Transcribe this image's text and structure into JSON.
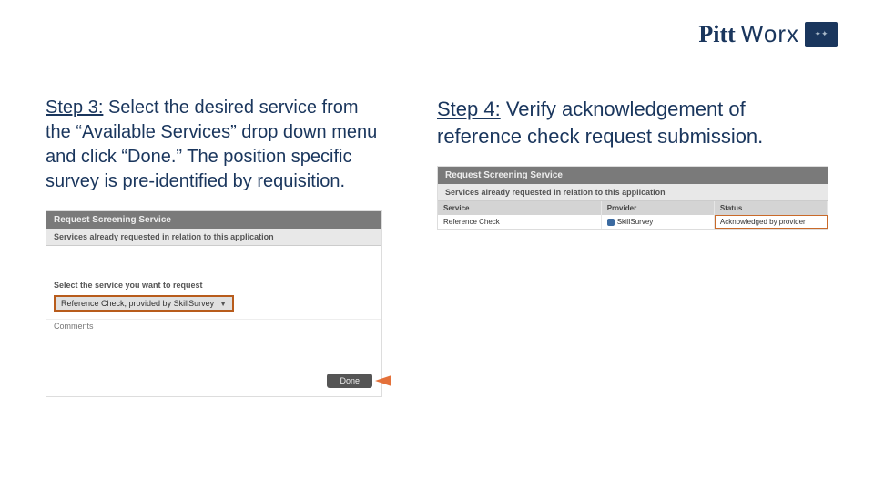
{
  "logo": {
    "brand1": "Pitt",
    "brand2": "Worx"
  },
  "step3": {
    "label": "Step 3:",
    "text": " Select the desired service from the “Available Services” drop down menu and click “Done.” The position specific survey is pre-identified by requisition."
  },
  "step4": {
    "label": "Step 4:",
    "text": " Verify acknowledgement of reference check request submission."
  },
  "left_panel": {
    "title": "Request Screening Service",
    "subtitle": "Services already requested in relation to this application",
    "section_label": "Select the service you want to request",
    "dropdown_value": "Reference Check, provided by SkillSurvey",
    "comments_label": "Comments",
    "done_label": "Done"
  },
  "right_panel": {
    "title": "Request Screening Service",
    "subtitle": "Services already requested in relation to this application",
    "headers": {
      "service": "Service",
      "provider": "Provider",
      "status": "Status"
    },
    "row": {
      "service": "Reference Check",
      "provider": "SkillSurvey",
      "status": "Acknowledged by provider"
    }
  }
}
